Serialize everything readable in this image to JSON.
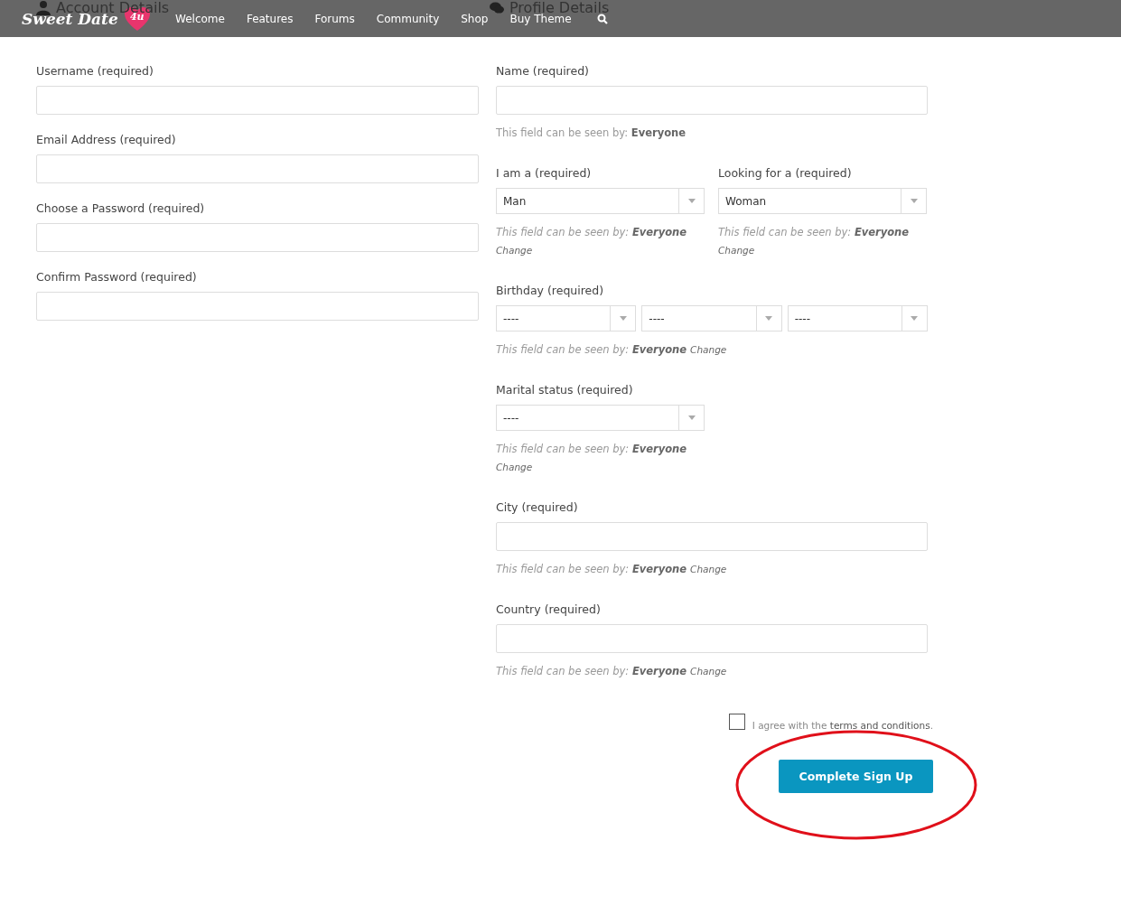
{
  "logo": {
    "text": "Sweet Date",
    "badge": "4u"
  },
  "nav": {
    "items": [
      "Welcome",
      "Features",
      "Forums",
      "Community",
      "Shop",
      "Buy Theme"
    ]
  },
  "headings": {
    "account": "Account Details",
    "profile": "Profile Details"
  },
  "account_fields": [
    {
      "label": "Username (required)"
    },
    {
      "label": "Email Address (required)"
    },
    {
      "label": "Choose a Password (required)"
    },
    {
      "label": "Confirm Password (required)"
    }
  ],
  "profile_fields": [
    {
      "kind": "text",
      "label": "Name (required)",
      "visibility": {
        "text": "This field can be seen by: **Everyone**",
        "italic": false
      }
    },
    {
      "kind": "pair",
      "items": [
        {
          "label": "I am a (required)",
          "value": "Man",
          "visibility": {
            "text": "This field can be seen by: **Everyone**",
            "italic": true,
            "change": "Change"
          }
        },
        {
          "label": "Looking for a (required)",
          "value": "Woman",
          "visibility": {
            "text": "This field can be seen by: **Everyone**",
            "italic": true,
            "change": "Change"
          }
        }
      ]
    },
    {
      "kind": "date",
      "label": "Birthday (required)",
      "values": [
        "----",
        "----",
        "----"
      ],
      "visibility": {
        "text": "This field can be seen by: **Everyone**",
        "italic": true,
        "change": "Change"
      }
    },
    {
      "kind": "select",
      "label": "Marital status (required)",
      "value": "----",
      "visibility": {
        "text": "This field can be seen by: **Everyone**",
        "italic": true,
        "change": "Change"
      }
    },
    {
      "kind": "text",
      "label": "City (required)",
      "visibility": {
        "text": "This field can be seen by: **Everyone**",
        "italic": true,
        "change": "Change"
      }
    },
    {
      "kind": "text",
      "label": "Country (required)",
      "visibility": {
        "text": "This field can be seen by: **Everyone**",
        "italic": true,
        "change": "Change"
      }
    }
  ],
  "terms": {
    "checked": false,
    "prefix": "I agree with the",
    "link": "terms and conditions",
    "suffix": "."
  },
  "submit": "Complete Sign Up"
}
